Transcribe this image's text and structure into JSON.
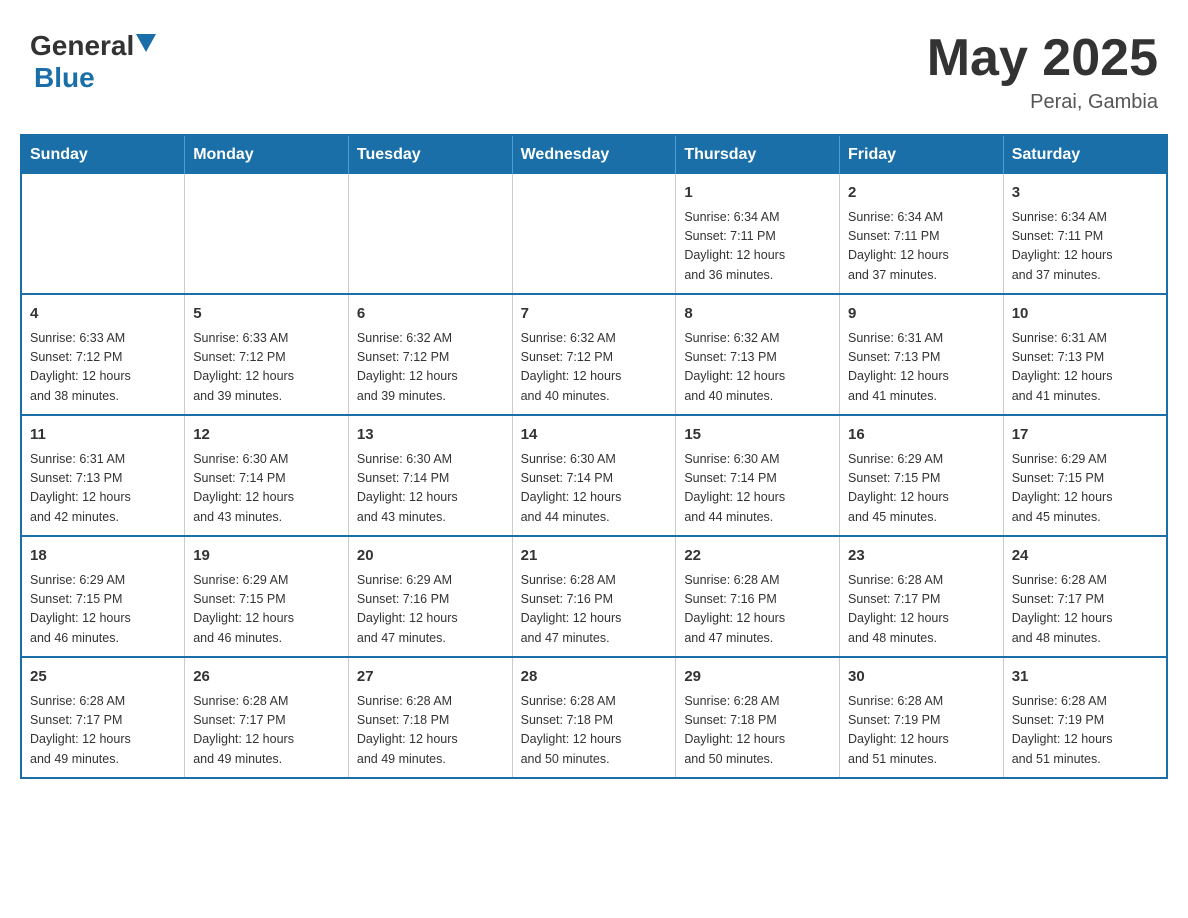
{
  "header": {
    "logo_general": "General",
    "logo_blue": "Blue",
    "month_title": "May 2025",
    "location": "Perai, Gambia"
  },
  "weekdays": [
    "Sunday",
    "Monday",
    "Tuesday",
    "Wednesday",
    "Thursday",
    "Friday",
    "Saturday"
  ],
  "weeks": [
    [
      {
        "day": "",
        "info": ""
      },
      {
        "day": "",
        "info": ""
      },
      {
        "day": "",
        "info": ""
      },
      {
        "day": "",
        "info": ""
      },
      {
        "day": "1",
        "info": "Sunrise: 6:34 AM\nSunset: 7:11 PM\nDaylight: 12 hours\nand 36 minutes."
      },
      {
        "day": "2",
        "info": "Sunrise: 6:34 AM\nSunset: 7:11 PM\nDaylight: 12 hours\nand 37 minutes."
      },
      {
        "day": "3",
        "info": "Sunrise: 6:34 AM\nSunset: 7:11 PM\nDaylight: 12 hours\nand 37 minutes."
      }
    ],
    [
      {
        "day": "4",
        "info": "Sunrise: 6:33 AM\nSunset: 7:12 PM\nDaylight: 12 hours\nand 38 minutes."
      },
      {
        "day": "5",
        "info": "Sunrise: 6:33 AM\nSunset: 7:12 PM\nDaylight: 12 hours\nand 39 minutes."
      },
      {
        "day": "6",
        "info": "Sunrise: 6:32 AM\nSunset: 7:12 PM\nDaylight: 12 hours\nand 39 minutes."
      },
      {
        "day": "7",
        "info": "Sunrise: 6:32 AM\nSunset: 7:12 PM\nDaylight: 12 hours\nand 40 minutes."
      },
      {
        "day": "8",
        "info": "Sunrise: 6:32 AM\nSunset: 7:13 PM\nDaylight: 12 hours\nand 40 minutes."
      },
      {
        "day": "9",
        "info": "Sunrise: 6:31 AM\nSunset: 7:13 PM\nDaylight: 12 hours\nand 41 minutes."
      },
      {
        "day": "10",
        "info": "Sunrise: 6:31 AM\nSunset: 7:13 PM\nDaylight: 12 hours\nand 41 minutes."
      }
    ],
    [
      {
        "day": "11",
        "info": "Sunrise: 6:31 AM\nSunset: 7:13 PM\nDaylight: 12 hours\nand 42 minutes."
      },
      {
        "day": "12",
        "info": "Sunrise: 6:30 AM\nSunset: 7:14 PM\nDaylight: 12 hours\nand 43 minutes."
      },
      {
        "day": "13",
        "info": "Sunrise: 6:30 AM\nSunset: 7:14 PM\nDaylight: 12 hours\nand 43 minutes."
      },
      {
        "day": "14",
        "info": "Sunrise: 6:30 AM\nSunset: 7:14 PM\nDaylight: 12 hours\nand 44 minutes."
      },
      {
        "day": "15",
        "info": "Sunrise: 6:30 AM\nSunset: 7:14 PM\nDaylight: 12 hours\nand 44 minutes."
      },
      {
        "day": "16",
        "info": "Sunrise: 6:29 AM\nSunset: 7:15 PM\nDaylight: 12 hours\nand 45 minutes."
      },
      {
        "day": "17",
        "info": "Sunrise: 6:29 AM\nSunset: 7:15 PM\nDaylight: 12 hours\nand 45 minutes."
      }
    ],
    [
      {
        "day": "18",
        "info": "Sunrise: 6:29 AM\nSunset: 7:15 PM\nDaylight: 12 hours\nand 46 minutes."
      },
      {
        "day": "19",
        "info": "Sunrise: 6:29 AM\nSunset: 7:15 PM\nDaylight: 12 hours\nand 46 minutes."
      },
      {
        "day": "20",
        "info": "Sunrise: 6:29 AM\nSunset: 7:16 PM\nDaylight: 12 hours\nand 47 minutes."
      },
      {
        "day": "21",
        "info": "Sunrise: 6:28 AM\nSunset: 7:16 PM\nDaylight: 12 hours\nand 47 minutes."
      },
      {
        "day": "22",
        "info": "Sunrise: 6:28 AM\nSunset: 7:16 PM\nDaylight: 12 hours\nand 47 minutes."
      },
      {
        "day": "23",
        "info": "Sunrise: 6:28 AM\nSunset: 7:17 PM\nDaylight: 12 hours\nand 48 minutes."
      },
      {
        "day": "24",
        "info": "Sunrise: 6:28 AM\nSunset: 7:17 PM\nDaylight: 12 hours\nand 48 minutes."
      }
    ],
    [
      {
        "day": "25",
        "info": "Sunrise: 6:28 AM\nSunset: 7:17 PM\nDaylight: 12 hours\nand 49 minutes."
      },
      {
        "day": "26",
        "info": "Sunrise: 6:28 AM\nSunset: 7:17 PM\nDaylight: 12 hours\nand 49 minutes."
      },
      {
        "day": "27",
        "info": "Sunrise: 6:28 AM\nSunset: 7:18 PM\nDaylight: 12 hours\nand 49 minutes."
      },
      {
        "day": "28",
        "info": "Sunrise: 6:28 AM\nSunset: 7:18 PM\nDaylight: 12 hours\nand 50 minutes."
      },
      {
        "day": "29",
        "info": "Sunrise: 6:28 AM\nSunset: 7:18 PM\nDaylight: 12 hours\nand 50 minutes."
      },
      {
        "day": "30",
        "info": "Sunrise: 6:28 AM\nSunset: 7:19 PM\nDaylight: 12 hours\nand 51 minutes."
      },
      {
        "day": "31",
        "info": "Sunrise: 6:28 AM\nSunset: 7:19 PM\nDaylight: 12 hours\nand 51 minutes."
      }
    ]
  ]
}
